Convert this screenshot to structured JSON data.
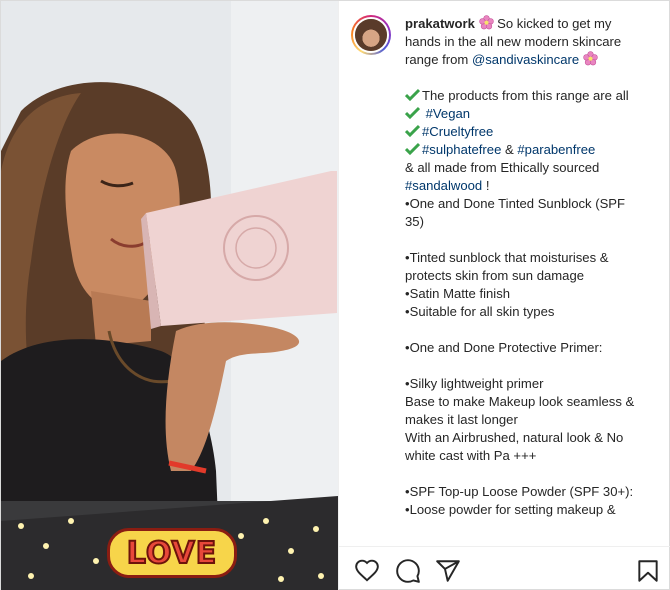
{
  "post": {
    "username": "prakatwork",
    "caption": {
      "line_intro": "So kicked to get my hands in the all new modern skincare range from",
      "mention": "@sandivaskincare",
      "products_line": "The products from this range are all",
      "tag_vegan": "#Vegan",
      "tag_crueltyfree": "#Crueltyfree",
      "tag_sulphatefree": "#sulphatefree",
      "amp": "&",
      "tag_parabenfree": "#parabenfree",
      "sourced_line": "& all made from Ethically sourced",
      "tag_sandalwood": "#sandalwood",
      "exclaim": "!",
      "p1_title": "•One and Done Tinted Sunblock (SPF 35)",
      "p1_b1": "•Tinted sunblock that moisturises & protects skin from sun damage",
      "p1_b2": "•Satin Matte finish",
      "p1_b3": "•Suitable for all skin types",
      "p2_title": "•One and Done Protective Primer:",
      "p2_b1": "•Silky lightweight primer",
      "p2_b2": "Base to make Makeup look seamless & makes it last longer",
      "p2_b3": "With an Airbrushed, natural look & No white cast with Pa +++",
      "p3_title": "•SPF Top-up Loose Powder (SPF 30+):",
      "p3_b1": "•Loose powder for setting makeup &"
    }
  },
  "media": {
    "sticker_text": "LOVE"
  },
  "icons": {
    "like": "heart-icon",
    "comment": "comment-icon",
    "share": "paper-plane-icon",
    "save": "bookmark-icon"
  },
  "colors": {
    "link": "#00376b",
    "check": "#3aa34a",
    "flower": "#e985c0",
    "text": "#262626"
  }
}
